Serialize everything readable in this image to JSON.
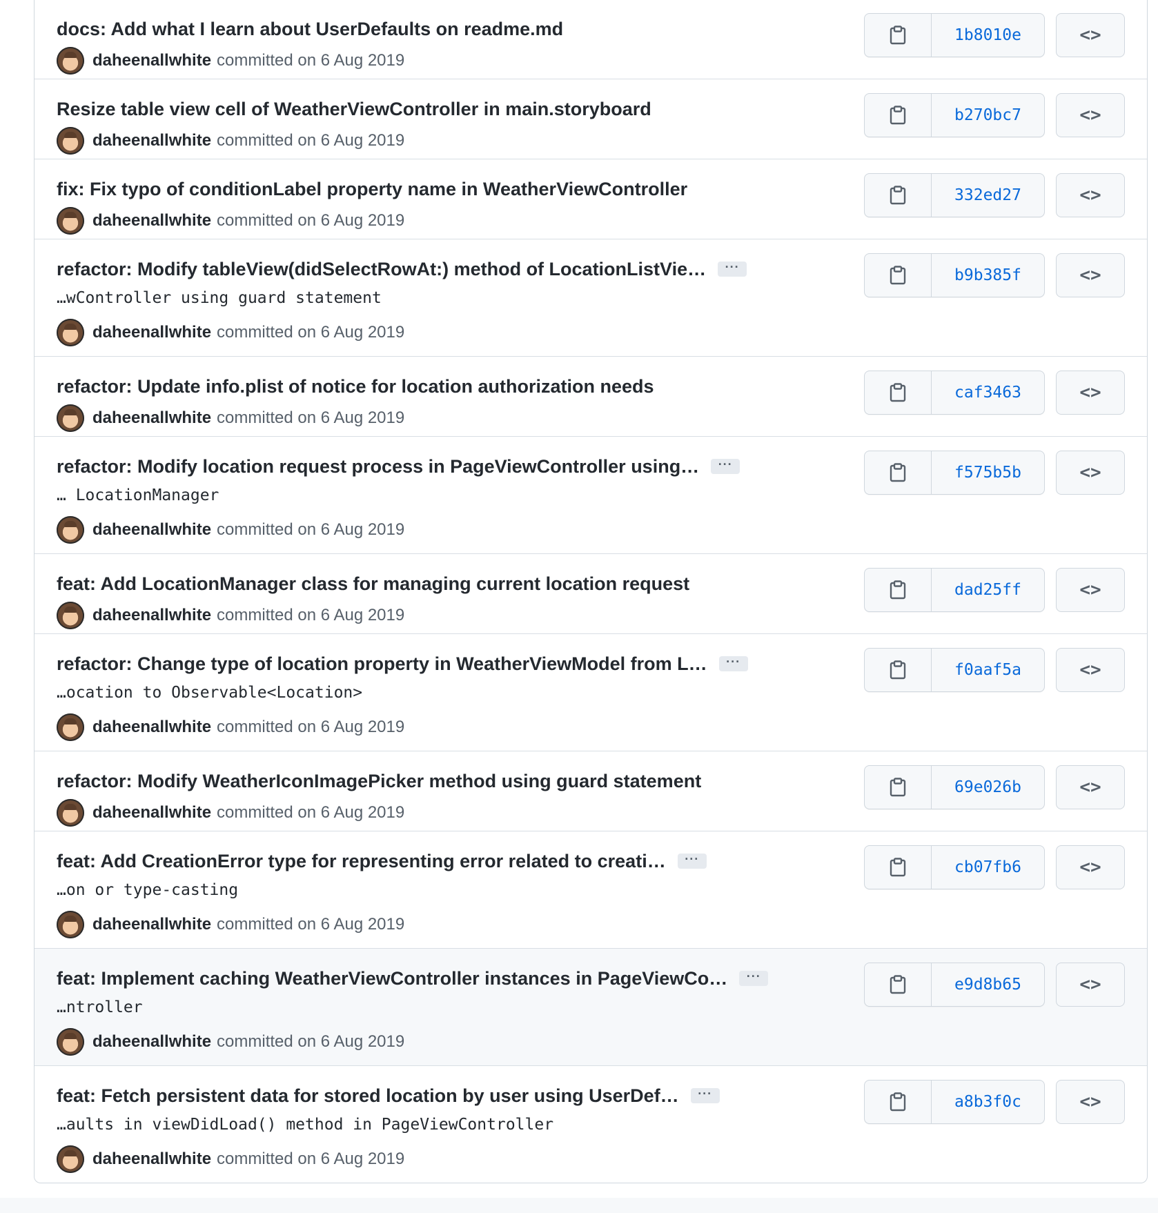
{
  "commit_meta": {
    "committed_text": "committed on 6 Aug 2019"
  },
  "browse_label": "<>",
  "ellipsis_label": "···",
  "commits": [
    {
      "title": "docs: Add what I learn about UserDefaults on readme.md",
      "author": "daheenallwhite",
      "sha": "1b8010e"
    },
    {
      "title": "Resize table view cell of WeatherViewController in main.storyboard",
      "author": "daheenallwhite",
      "sha": "b270bc7"
    },
    {
      "title": "fix: Fix typo of conditionLabel property name in WeatherViewController",
      "author": "daheenallwhite",
      "sha": "332ed27"
    },
    {
      "title": "refactor: Modify tableView(didSelectRowAt:) method of LocationListVie…",
      "desc": "…wController using guard statement",
      "author": "daheenallwhite",
      "sha": "b9b385f"
    },
    {
      "title": "refactor: Update info.plist of notice for location authorization needs",
      "author": "daheenallwhite",
      "sha": "caf3463"
    },
    {
      "title": "refactor: Modify location request process in PageViewController using…",
      "desc": "… LocationManager",
      "author": "daheenallwhite",
      "sha": "f575b5b"
    },
    {
      "title": "feat: Add LocationManager class for managing current location request",
      "author": "daheenallwhite",
      "sha": "dad25ff"
    },
    {
      "title": "refactor: Change type of location property in WeatherViewModel from L…",
      "desc": "…ocation to Observable<Location>",
      "author": "daheenallwhite",
      "sha": "f0aaf5a"
    },
    {
      "title": "refactor: Modify WeatherIconImagePicker method using guard statement",
      "author": "daheenallwhite",
      "sha": "69e026b"
    },
    {
      "title": "feat: Add CreationError type for representing error related to creati…",
      "desc": "…on or type-casting",
      "author": "daheenallwhite",
      "sha": "cb07fb6"
    },
    {
      "title": "feat: Implement caching WeatherViewController instances in PageViewCo…",
      "desc": "…ntroller",
      "author": "daheenallwhite",
      "sha": "e9d8b65",
      "hover": true
    },
    {
      "title": "feat: Fetch persistent data for stored location by user using UserDef…",
      "desc": "…aults in viewDidLoad() method in PageViewController",
      "author": "daheenallwhite",
      "sha": "a8b3f0c"
    }
  ],
  "colors": {
    "sha_link": "#0969da",
    "title_text": "#24292f",
    "muted_text": "#57606a",
    "border": "#d0d7de",
    "hover_row": "#f6f8fa"
  }
}
